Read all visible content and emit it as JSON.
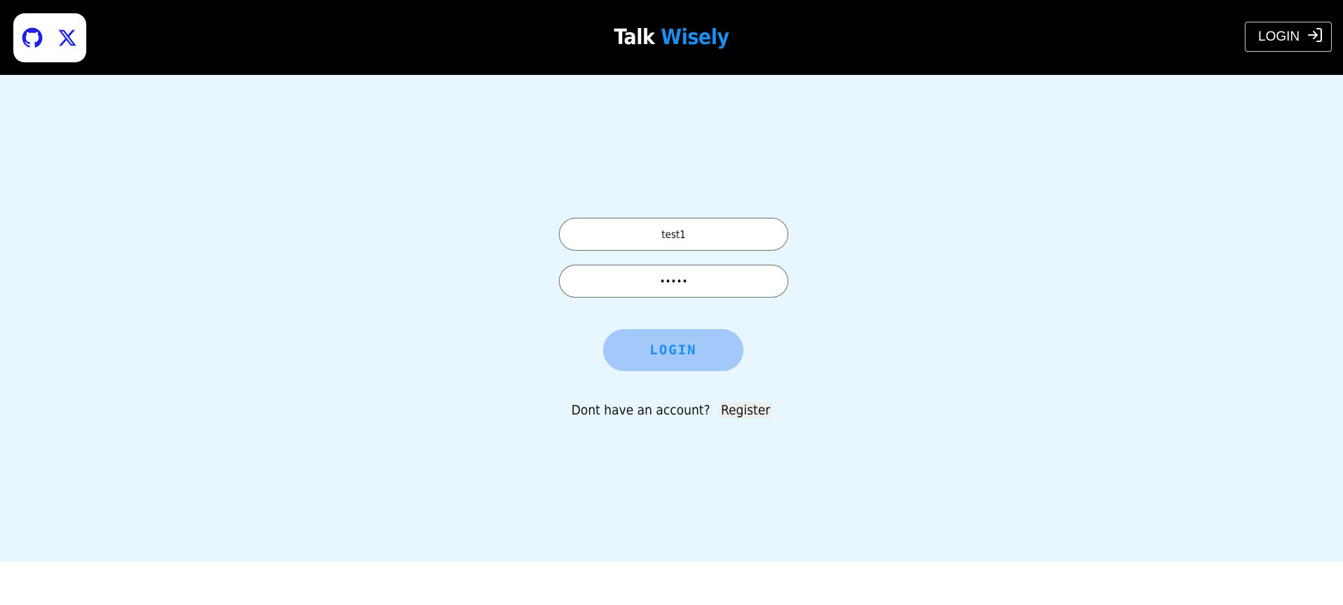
{
  "header": {
    "brand_first": "Talk",
    "brand_second": "Wisely",
    "brand_accent_color": "#1a8ff0",
    "social_icons": [
      "github-icon",
      "x-icon"
    ],
    "login_label": "LOGIN",
    "login_icon": "login-icon"
  },
  "form": {
    "username_value": "test1",
    "password_value": "•••••",
    "submit_label": "LOGIN",
    "submit_color": "#a3c9fb"
  },
  "register": {
    "prompt": "Dont have an account?",
    "link_label": "Register"
  }
}
